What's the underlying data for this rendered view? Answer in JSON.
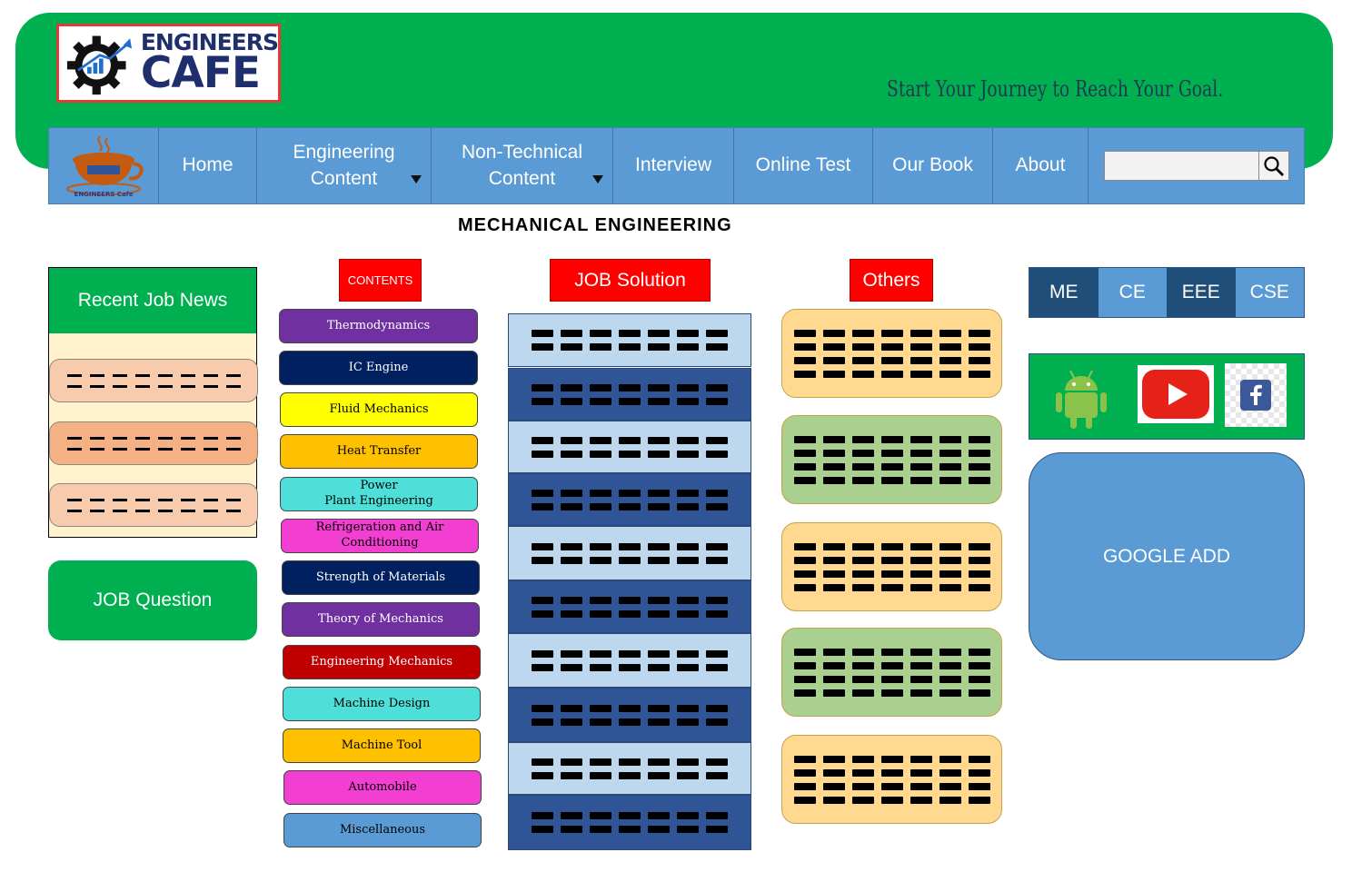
{
  "header": {
    "logo_line1": "ENGINEERS",
    "logo_line2": "CAFE",
    "tagline": "Start Your Journey to Reach Your Goal.",
    "nav_logo_text": "ENGINEERS Cafe"
  },
  "nav": {
    "home": "Home",
    "engineering_l1": "Engineering",
    "engineering_l2": "Content",
    "nontech_l1": "Non-Technical",
    "nontech_l2": "Content",
    "interview": "Interview",
    "online_test": "Online Test",
    "our_book": "Our Book",
    "about": "About",
    "search_value": ""
  },
  "page_title": "MECHANICAL  ENGINEERING",
  "recent_job_news": {
    "title": "Recent Job News",
    "item_colors": [
      "#f8cbad",
      "#f4b183",
      "#f8cbad"
    ]
  },
  "job_question": "JOB Question",
  "contents": {
    "label": "CONTENTS",
    "items": [
      {
        "label": "Thermodynamics",
        "bg": "#7030a0",
        "fg": "#ffffff"
      },
      {
        "label": "IC Engine",
        "bg": "#002060",
        "fg": "#ffffff"
      },
      {
        "label": "Fluid  Mechanics",
        "bg": "#ffff00",
        "fg": "#000000"
      },
      {
        "label": "Heat Transfer",
        "bg": "#ffc000",
        "fg": "#000000"
      },
      {
        "label": "Power\nPlant Engineering",
        "bg": "#4edfd9",
        "fg": "#000000"
      },
      {
        "label": "Refrigeration and Air\nConditioning",
        "bg": "#f23fd1",
        "fg": "#000000"
      },
      {
        "label": "Strength of Materials",
        "bg": "#002060",
        "fg": "#ffffff"
      },
      {
        "label": "Theory of Mechanics",
        "bg": "#7030a0",
        "fg": "#ffffff"
      },
      {
        "label": "Engineering Mechanics",
        "bg": "#c00000",
        "fg": "#ffffff"
      },
      {
        "label": "Machine Design",
        "bg": "#4edfd9",
        "fg": "#000000"
      },
      {
        "label": "Machine Tool",
        "bg": "#ffc000",
        "fg": "#000000"
      },
      {
        "label": "Automobile",
        "bg": "#f23fd1",
        "fg": "#000000"
      },
      {
        "label": "Miscellaneous",
        "bg": "#5b9bd5",
        "fg": "#000000"
      }
    ]
  },
  "job_solution": {
    "label": "JOB Solution",
    "row_colors": [
      "#bdd7ee",
      "#2f5597",
      "#bdd7ee",
      "#2f5597",
      "#bdd7ee",
      "#2f5597",
      "#bdd7ee",
      "#2f5597",
      "#bdd7ee",
      "#2f5597"
    ]
  },
  "others": {
    "label": "Others",
    "card_colors": [
      "#ffd98f",
      "#a9d08e",
      "#ffd98f",
      "#a9d08e",
      "#ffd98f"
    ]
  },
  "branches": [
    {
      "label": "ME",
      "bg": "#1f4e79"
    },
    {
      "label": "CE",
      "bg": "#5b9bd5"
    },
    {
      "label": "EEE",
      "bg": "#1f4e79"
    },
    {
      "label": "CSE",
      "bg": "#5b9bd5"
    }
  ],
  "social": {
    "icons": [
      "android-icon",
      "youtube-icon",
      "facebook-icon"
    ],
    "android_color": "#8bc34a",
    "youtube_color": "#e62117",
    "facebook_color": "#3b5998"
  },
  "google_add": "GOOGLE ADD",
  "colors": {
    "header_green": "#00b050",
    "nav_blue": "#5b9bd5",
    "label_red": "#ff0000"
  }
}
